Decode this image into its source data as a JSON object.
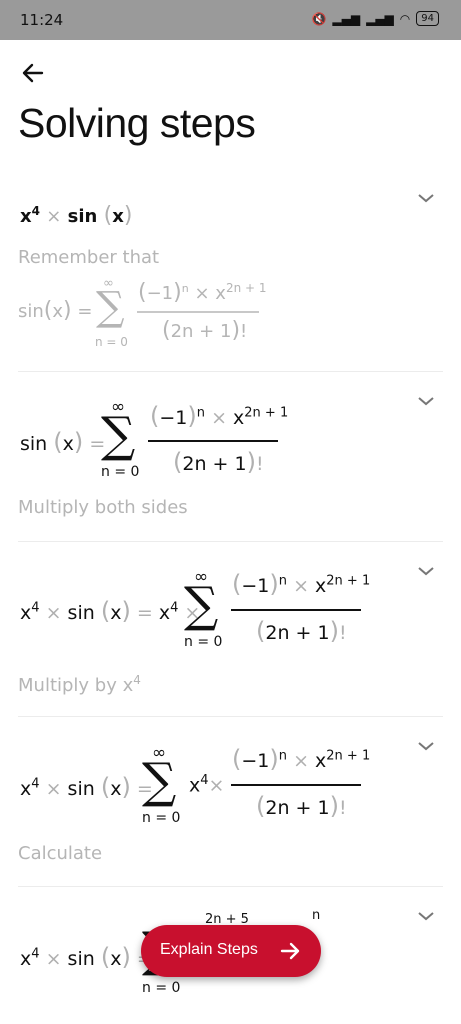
{
  "status": {
    "time": "11:24",
    "battery": "94"
  },
  "header": {
    "title": "Solving steps"
  },
  "steps": [
    {
      "caption": "Remember that"
    },
    {
      "caption": "Multiply both sides"
    },
    {
      "caption": "Multiply by x",
      "caption_sup": "4"
    },
    {
      "caption": "Calculate"
    }
  ],
  "math": {
    "x": "x",
    "four": "4",
    "times": "×",
    "sin": "sin",
    "lp": "(",
    "rp": ")",
    "eq": "=",
    "inf": "∞",
    "n0": "n = 0",
    "neg1": "−1",
    "n": "n",
    "exp": "2n + 1",
    "den": "2n + 1",
    "fact": "!",
    "exp5": "2n + 5"
  },
  "fab": {
    "label": "Explain Steps"
  },
  "icons": {
    "back": "back-arrow-icon",
    "chevron": "chevron-down-icon",
    "fab_arrow": "arrow-right-icon"
  }
}
